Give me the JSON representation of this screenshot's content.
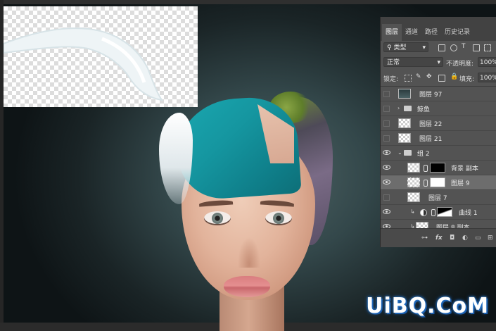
{
  "panel": {
    "tabs": [
      "图层",
      "通道",
      "路径",
      "历史记录"
    ],
    "active_tab": "图层",
    "filter_kind": "类型",
    "blend_mode": "正常",
    "opacity_label": "不透明度:",
    "opacity_value": "100%",
    "lock_label": "锁定:",
    "fill_label": "填充:",
    "fill_value": "100%"
  },
  "layers": [
    {
      "name": "图层 97",
      "visible": false,
      "type": "layer"
    },
    {
      "name": "鲸鱼",
      "visible": false,
      "type": "group"
    },
    {
      "name": "图层 22",
      "visible": false,
      "type": "layer"
    },
    {
      "name": "图层 21",
      "visible": false,
      "type": "layer"
    },
    {
      "name": "组 2",
      "visible": true,
      "type": "group"
    },
    {
      "name": "背景 副本",
      "visible": true,
      "type": "masked"
    },
    {
      "name": "图层 9",
      "visible": true,
      "type": "masked",
      "selected": true
    },
    {
      "name": "图层 7",
      "visible": false,
      "type": "layer"
    },
    {
      "name": "曲线 1",
      "visible": true,
      "type": "adjustment"
    },
    {
      "name": "图层 8 副本",
      "visible": true,
      "type": "layer"
    }
  ],
  "bottom_icons": [
    "link-icon",
    "fx-icon",
    "mask-icon",
    "adjustment-icon",
    "folder-icon",
    "new-layer-icon"
  ],
  "bottom_fx_label": "fx",
  "watermark": "UiBQ.CoM",
  "colors": {
    "panel_bg": "#535353",
    "selected_row": "#6d6d6d",
    "hair": "#1aa7b0"
  }
}
